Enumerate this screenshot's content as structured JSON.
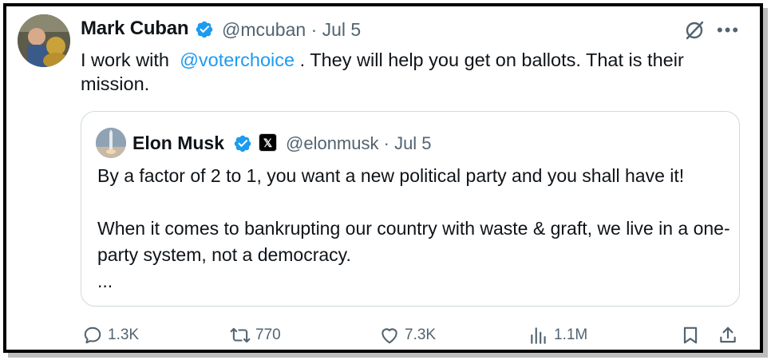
{
  "author": {
    "name": "Mark Cuban",
    "handle": "@mcuban",
    "date": "· Jul 5",
    "verified": true
  },
  "tweet": {
    "text_before": "I work with",
    "mention": "@voterchoice",
    "text_after": ".   They will help you get on ballots. That is their mission."
  },
  "quote": {
    "name": "Elon Musk",
    "badge": "𝕏",
    "handle": "@elonmusk",
    "date": "· Jul 5",
    "paragraph1": "By a factor of 2 to 1, you want a new political party and you shall have it!",
    "paragraph2": "When it comes to bankrupting our country with waste & graft, we live in a one-party system, not a democracy.",
    "ellipsis": "..."
  },
  "actions": {
    "replies": "1.3K",
    "reposts": "770",
    "likes": "7.3K",
    "views": "1.1M"
  },
  "colors": {
    "accent": "#1d9bf0",
    "secondary_text": "#536471",
    "border": "#cfd9de"
  },
  "icons": {
    "grok": "grok-icon",
    "more": "more-icon",
    "reply": "reply-icon",
    "repost": "repost-icon",
    "like": "heart-icon",
    "views": "analytics-icon",
    "bookmark": "bookmark-icon",
    "share": "share-icon"
  }
}
